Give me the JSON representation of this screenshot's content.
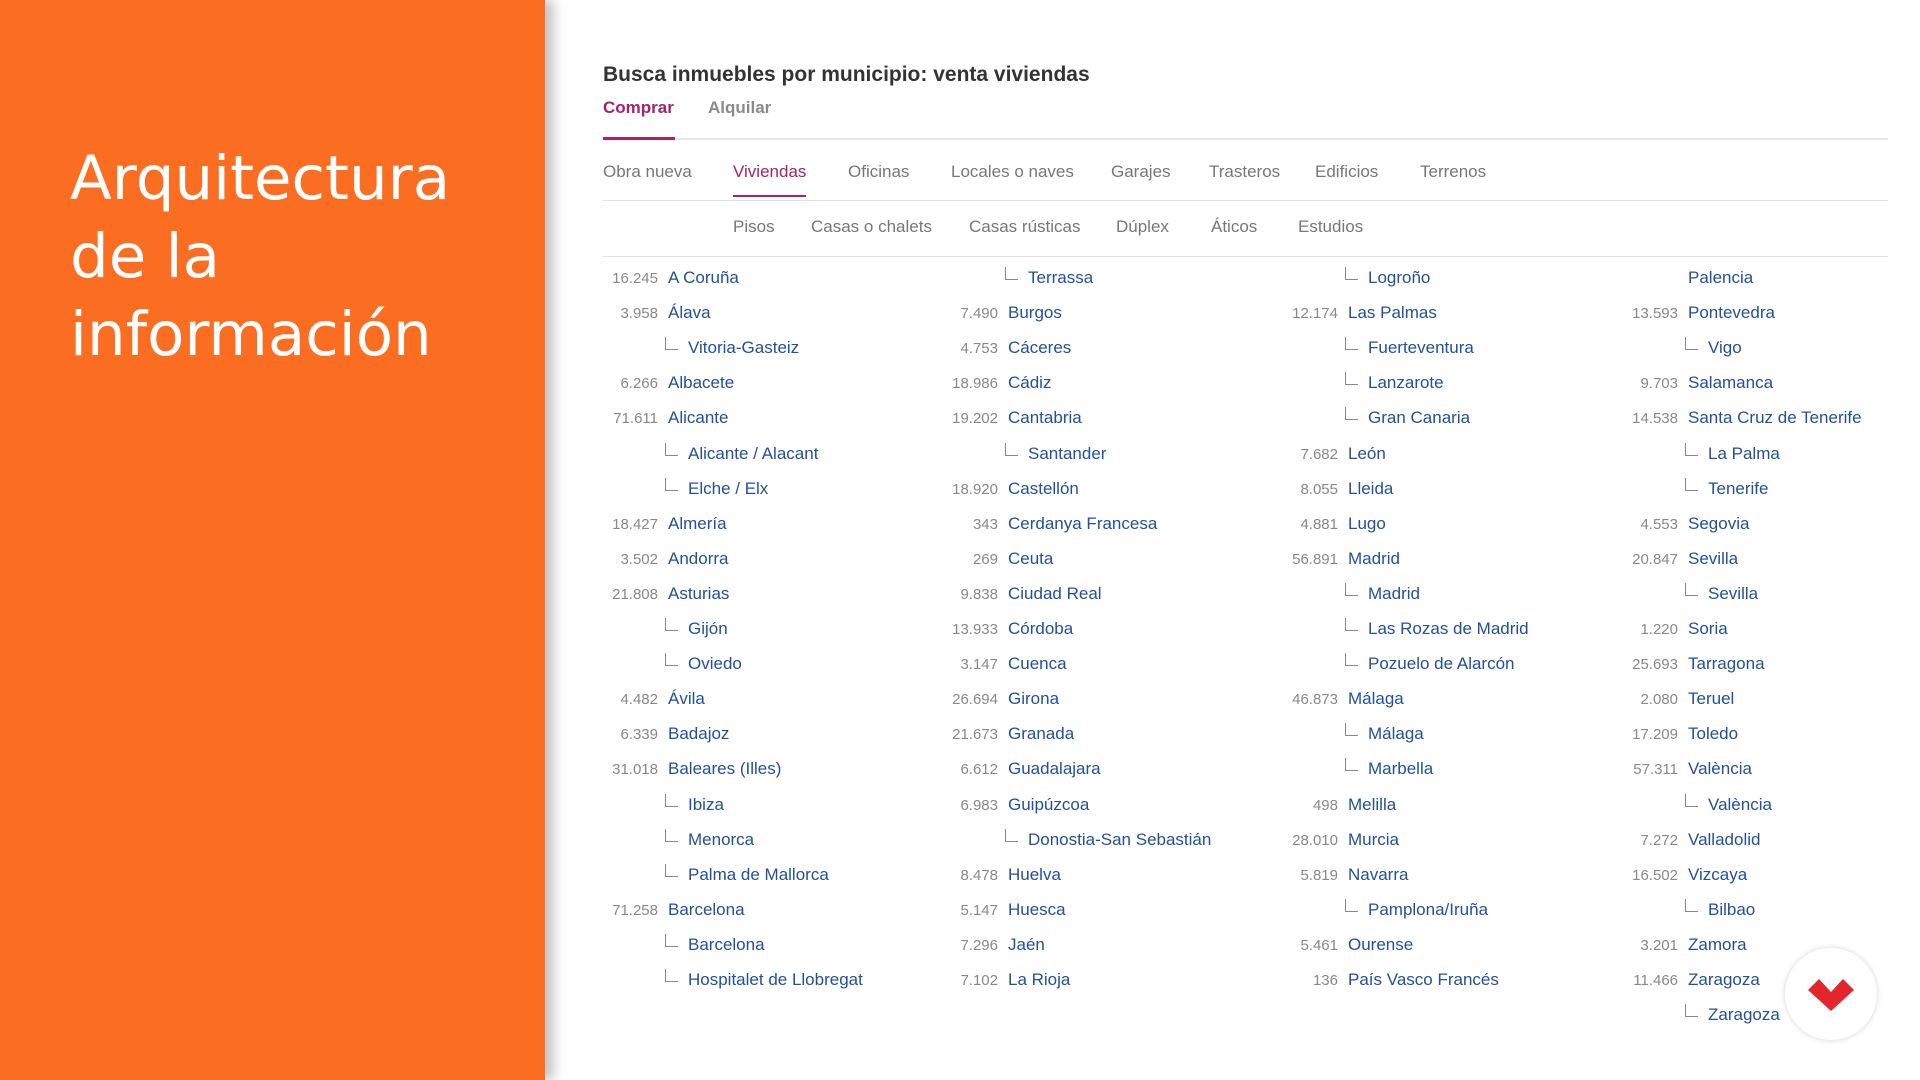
{
  "slide": {
    "title": "Arquitectura de la información"
  },
  "header": {
    "title": "Busca inmuebles por municipio: venta viviendas"
  },
  "operation_tabs": [
    {
      "label": "Comprar",
      "active": true
    },
    {
      "label": "Alquilar",
      "active": false
    }
  ],
  "type_tabs": [
    {
      "label": "Obra nueva",
      "active": false
    },
    {
      "label": "Viviendas",
      "active": true
    },
    {
      "label": "Oficinas",
      "active": false
    },
    {
      "label": "Locales o naves",
      "active": false
    },
    {
      "label": "Garajes",
      "active": false
    },
    {
      "label": "Trasteros",
      "active": false
    },
    {
      "label": "Edificios",
      "active": false
    },
    {
      "label": "Terrenos",
      "active": false
    }
  ],
  "sub_tabs": [
    {
      "label": "Pisos"
    },
    {
      "label": "Casas o chalets"
    },
    {
      "label": "Casas rústicas"
    },
    {
      "label": "Dúplex"
    },
    {
      "label": "Áticos"
    },
    {
      "label": "Estudios"
    }
  ],
  "columns": [
    [
      {
        "count": "16.245",
        "name": "A Coruña",
        "child": false
      },
      {
        "count": "3.958",
        "name": "Álava",
        "child": false
      },
      {
        "count": "",
        "name": "Vitoria-Gasteiz",
        "child": true
      },
      {
        "count": "6.266",
        "name": "Albacete",
        "child": false
      },
      {
        "count": "71.611",
        "name": "Alicante",
        "child": false
      },
      {
        "count": "",
        "name": "Alicante / Alacant",
        "child": true
      },
      {
        "count": "",
        "name": "Elche / Elx",
        "child": true
      },
      {
        "count": "18.427",
        "name": "Almería",
        "child": false
      },
      {
        "count": "3.502",
        "name": "Andorra",
        "child": false
      },
      {
        "count": "21.808",
        "name": "Asturias",
        "child": false
      },
      {
        "count": "",
        "name": "Gijón",
        "child": true
      },
      {
        "count": "",
        "name": "Oviedo",
        "child": true
      },
      {
        "count": "4.482",
        "name": "Ávila",
        "child": false
      },
      {
        "count": "6.339",
        "name": "Badajoz",
        "child": false
      },
      {
        "count": "31.018",
        "name": "Baleares (Illes)",
        "child": false
      },
      {
        "count": "",
        "name": "Ibiza",
        "child": true
      },
      {
        "count": "",
        "name": "Menorca",
        "child": true
      },
      {
        "count": "",
        "name": "Palma de Mallorca",
        "child": true
      },
      {
        "count": "71.258",
        "name": "Barcelona",
        "child": false
      },
      {
        "count": "",
        "name": "Barcelona",
        "child": true
      },
      {
        "count": "",
        "name": "Hospitalet de Llobregat",
        "child": true
      }
    ],
    [
      {
        "count": "",
        "name": "Terrassa",
        "child": true
      },
      {
        "count": "7.490",
        "name": "Burgos",
        "child": false
      },
      {
        "count": "4.753",
        "name": "Cáceres",
        "child": false
      },
      {
        "count": "18.986",
        "name": "Cádiz",
        "child": false
      },
      {
        "count": "19.202",
        "name": "Cantabria",
        "child": false
      },
      {
        "count": "",
        "name": "Santander",
        "child": true
      },
      {
        "count": "18.920",
        "name": "Castellón",
        "child": false
      },
      {
        "count": "343",
        "name": "Cerdanya Francesa",
        "child": false
      },
      {
        "count": "269",
        "name": "Ceuta",
        "child": false
      },
      {
        "count": "9.838",
        "name": "Ciudad Real",
        "child": false
      },
      {
        "count": "13.933",
        "name": "Córdoba",
        "child": false
      },
      {
        "count": "3.147",
        "name": "Cuenca",
        "child": false
      },
      {
        "count": "26.694",
        "name": "Girona",
        "child": false
      },
      {
        "count": "21.673",
        "name": "Granada",
        "child": false
      },
      {
        "count": "6.612",
        "name": "Guadalajara",
        "child": false
      },
      {
        "count": "6.983",
        "name": "Guipúzcoa",
        "child": false
      },
      {
        "count": "",
        "name": "Donostia-San Sebastián",
        "child": true
      },
      {
        "count": "8.478",
        "name": "Huelva",
        "child": false
      },
      {
        "count": "5.147",
        "name": "Huesca",
        "child": false
      },
      {
        "count": "7.296",
        "name": "Jaén",
        "child": false
      },
      {
        "count": "7.102",
        "name": "La Rioja",
        "child": false
      }
    ],
    [
      {
        "count": "",
        "name": "Logroño",
        "child": true
      },
      {
        "count": "12.174",
        "name": "Las Palmas",
        "child": false
      },
      {
        "count": "",
        "name": "Fuerteventura",
        "child": true
      },
      {
        "count": "",
        "name": "Lanzarote",
        "child": true
      },
      {
        "count": "",
        "name": "Gran Canaria",
        "child": true
      },
      {
        "count": "7.682",
        "name": "León",
        "child": false
      },
      {
        "count": "8.055",
        "name": "Lleida",
        "child": false
      },
      {
        "count": "4.881",
        "name": "Lugo",
        "child": false
      },
      {
        "count": "56.891",
        "name": "Madrid",
        "child": false
      },
      {
        "count": "",
        "name": "Madrid",
        "child": true
      },
      {
        "count": "",
        "name": "Las Rozas de Madrid",
        "child": true
      },
      {
        "count": "",
        "name": "Pozuelo de Alarcón",
        "child": true
      },
      {
        "count": "46.873",
        "name": "Málaga",
        "child": false
      },
      {
        "count": "",
        "name": "Málaga",
        "child": true
      },
      {
        "count": "",
        "name": "Marbella",
        "child": true
      },
      {
        "count": "498",
        "name": "Melilla",
        "child": false
      },
      {
        "count": "28.010",
        "name": "Murcia",
        "child": false
      },
      {
        "count": "5.819",
        "name": "Navarra",
        "child": false
      },
      {
        "count": "",
        "name": "Pamplona/Iruña",
        "child": true
      },
      {
        "count": "5.461",
        "name": "Ourense",
        "child": false
      },
      {
        "count": "136",
        "name": "País Vasco Francés",
        "child": false
      }
    ],
    [
      {
        "count": "",
        "name": "Palencia",
        "child": false
      },
      {
        "count": "13.593",
        "name": "Pontevedra",
        "child": false
      },
      {
        "count": "",
        "name": "Vigo",
        "child": true
      },
      {
        "count": "9.703",
        "name": "Salamanca",
        "child": false
      },
      {
        "count": "14.538",
        "name": "Santa Cruz de Tenerife",
        "child": false
      },
      {
        "count": "",
        "name": "La Palma",
        "child": true
      },
      {
        "count": "",
        "name": "Tenerife",
        "child": true
      },
      {
        "count": "4.553",
        "name": "Segovia",
        "child": false
      },
      {
        "count": "20.847",
        "name": "Sevilla",
        "child": false
      },
      {
        "count": "",
        "name": "Sevilla",
        "child": true
      },
      {
        "count": "1.220",
        "name": "Soria",
        "child": false
      },
      {
        "count": "25.693",
        "name": "Tarragona",
        "child": false
      },
      {
        "count": "2.080",
        "name": "Teruel",
        "child": false
      },
      {
        "count": "17.209",
        "name": "Toledo",
        "child": false
      },
      {
        "count": "57.311",
        "name": "València",
        "child": false
      },
      {
        "count": "",
        "name": "València",
        "child": true
      },
      {
        "count": "7.272",
        "name": "Valladolid",
        "child": false
      },
      {
        "count": "16.502",
        "name": "Vizcaya",
        "child": false
      },
      {
        "count": "",
        "name": "Bilbao",
        "child": true
      },
      {
        "count": "3.201",
        "name": "Zamora",
        "child": false
      },
      {
        "count": "11.466",
        "name": "Zaragoza",
        "child": false
      },
      {
        "count": "",
        "name": "Zaragoza",
        "child": true
      }
    ]
  ],
  "colors": {
    "accent": "#a4236a",
    "link": "#23509a",
    "slide_bg": "#fb6d21",
    "logo": "#e3262c"
  },
  "logo": {
    "icon": "logo-icon"
  }
}
